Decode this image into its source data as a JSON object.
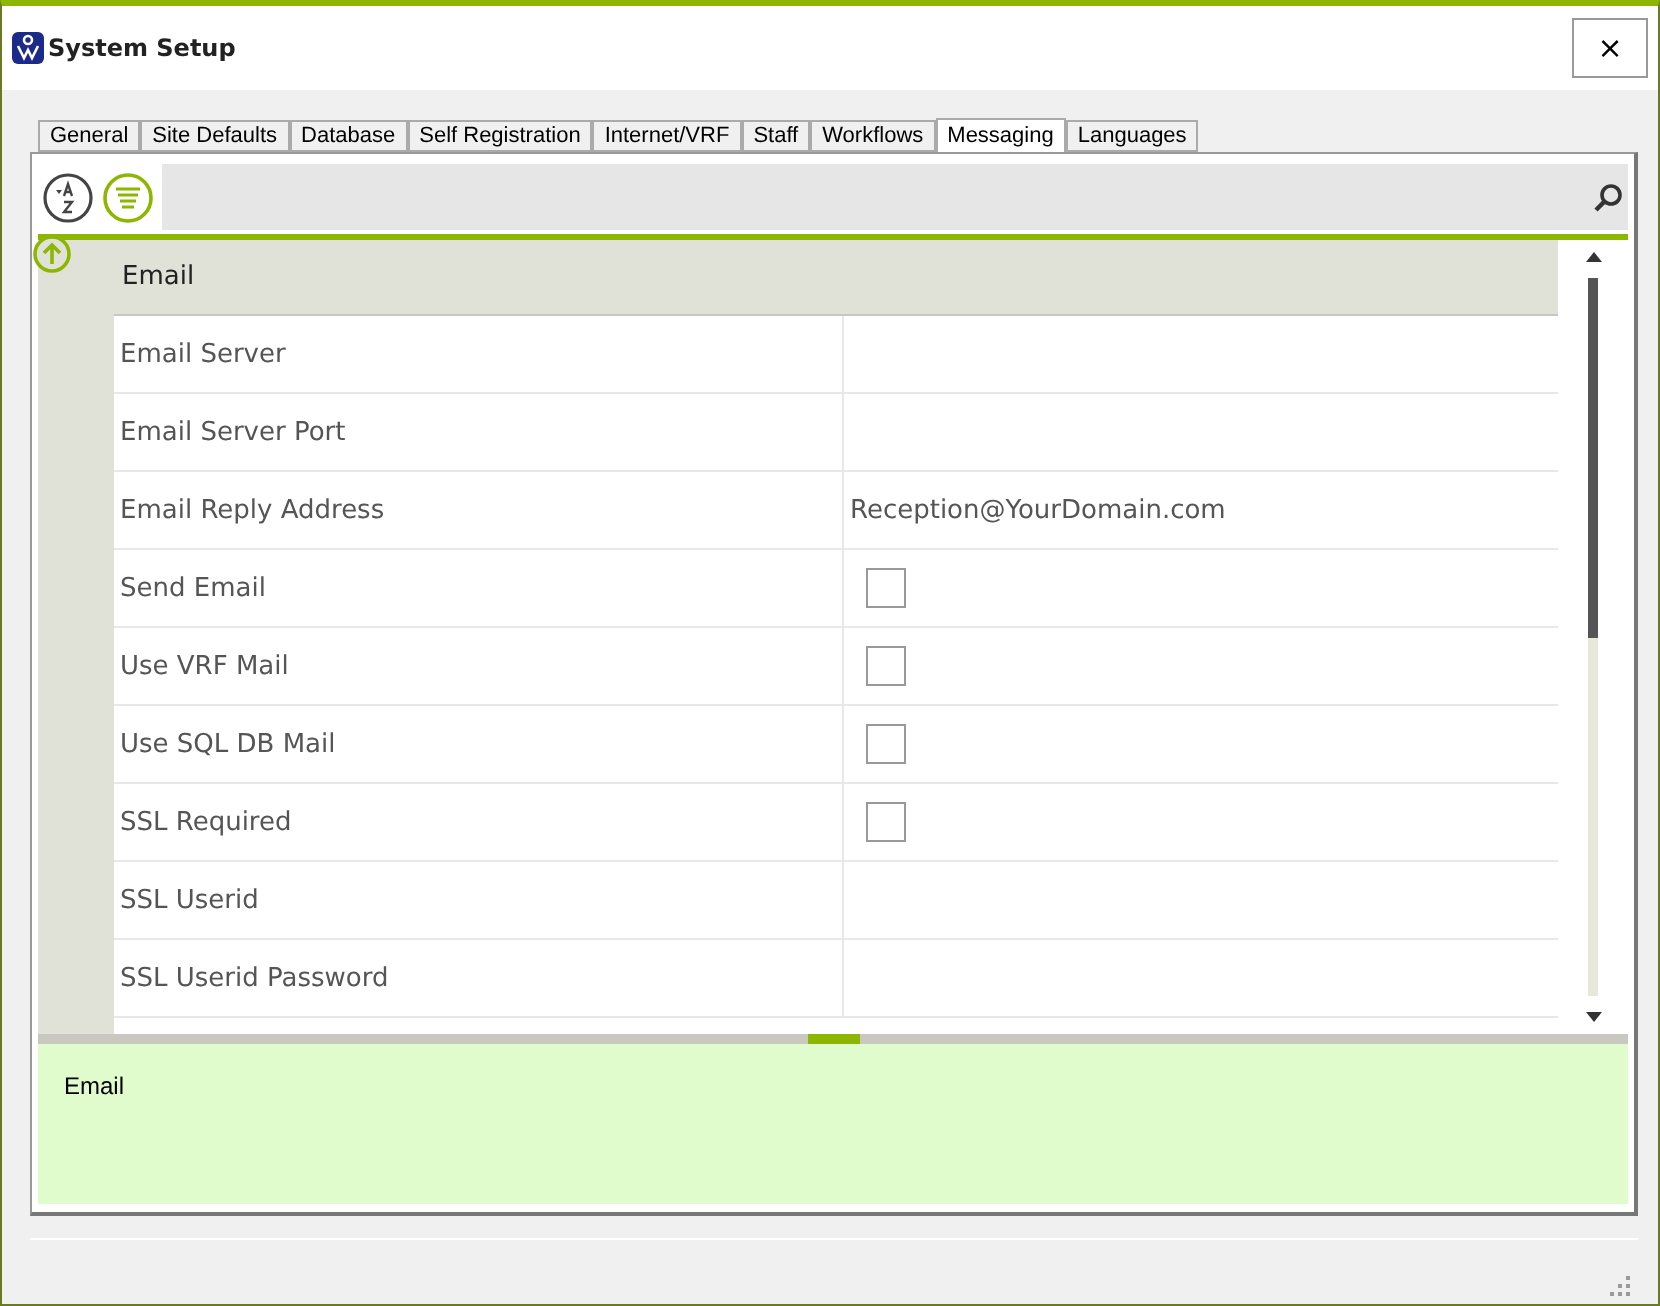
{
  "window": {
    "title": "System Setup",
    "close": "×"
  },
  "tabs": [
    {
      "label": "General",
      "selected": false
    },
    {
      "label": "Site Defaults",
      "selected": false
    },
    {
      "label": "Database",
      "selected": false
    },
    {
      "label": "Self Registration",
      "selected": false
    },
    {
      "label": "Internet/VRF",
      "selected": false
    },
    {
      "label": "Staff",
      "selected": false
    },
    {
      "label": "Workflows",
      "selected": false
    },
    {
      "label": "Messaging",
      "selected": true
    },
    {
      "label": "Languages",
      "selected": false
    }
  ],
  "category": "Email",
  "properties": [
    {
      "label": "Email Server",
      "kind": "text"
    },
    {
      "label": "Email Server Port",
      "kind": "text"
    },
    {
      "label": "Email Reply Address",
      "kind": "text",
      "value": "Reception@YourDomain.com"
    },
    {
      "label": "Send Email",
      "kind": "check",
      "checked": false
    },
    {
      "label": "Use VRF Mail",
      "kind": "check",
      "checked": false
    },
    {
      "label": "Use SQL DB Mail",
      "kind": "check",
      "checked": false
    },
    {
      "label": "SSL Required",
      "kind": "check",
      "checked": false
    },
    {
      "label": "SSL Userid",
      "kind": "text"
    },
    {
      "label": "SSL Userid Password",
      "kind": "text"
    }
  ],
  "description": "Email"
}
